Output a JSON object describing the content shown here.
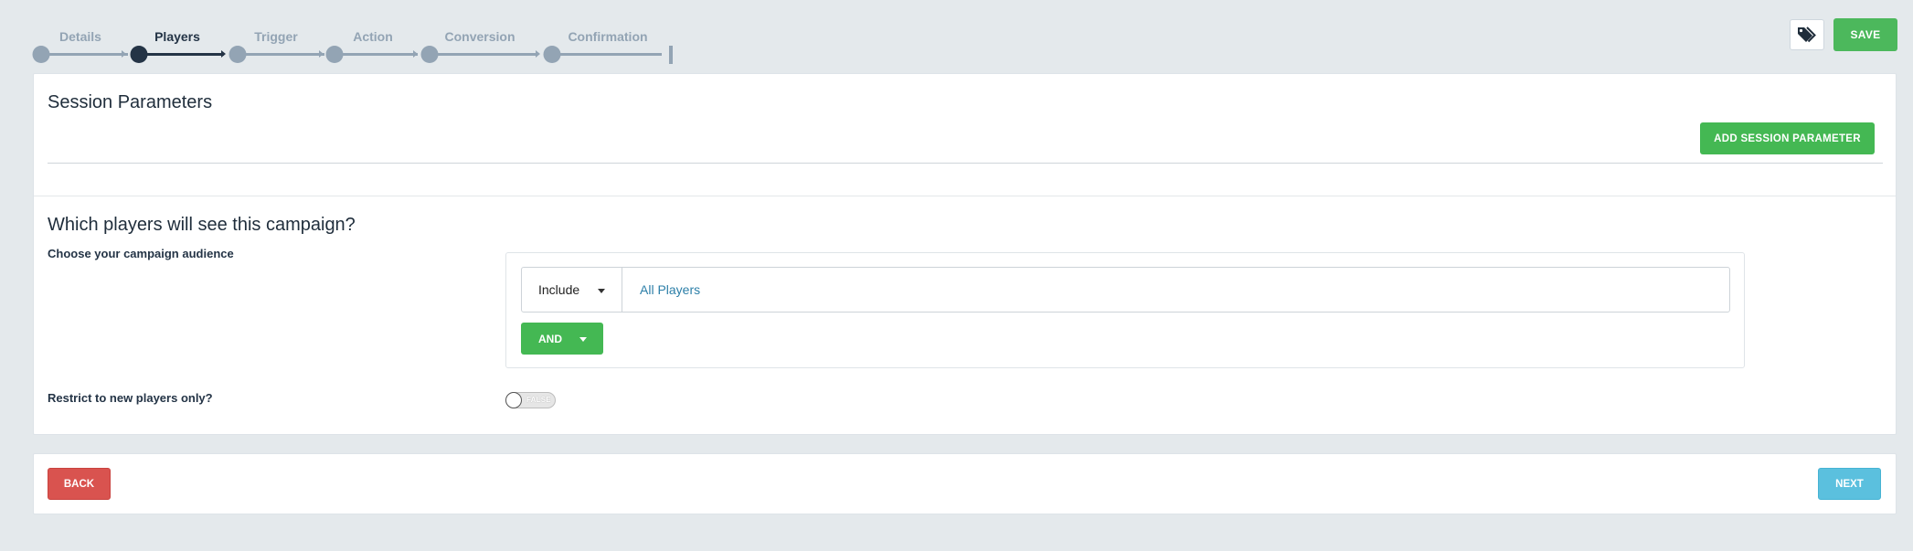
{
  "wizard": {
    "steps": [
      {
        "label": "Details",
        "active": false
      },
      {
        "label": "Players",
        "active": true
      },
      {
        "label": "Trigger",
        "active": false
      },
      {
        "label": "Action",
        "active": false
      },
      {
        "label": "Conversion",
        "active": false
      },
      {
        "label": "Confirmation",
        "active": false
      }
    ],
    "current_step": 2
  },
  "toolbar": {
    "tag_icon": "tags-icon",
    "save_label": "SAVE"
  },
  "session_parameters": {
    "title": "Session Parameters",
    "add_label": "ADD SESSION PARAMETER"
  },
  "audience": {
    "title": "Which players will see this campaign?",
    "choose_label": "Choose your campaign audience",
    "include_select": "Include",
    "segment": "All Players",
    "and_label": "AND"
  },
  "restrict": {
    "label": "Restrict to new players only?",
    "toggle_text": "FALSE"
  },
  "footer": {
    "back_label": "BACK",
    "next_label": "NEXT"
  },
  "colors": {
    "background": "#e4e9ec",
    "accent_green": "#4cb85c",
    "danger_red": "#d9534f",
    "info_blue": "#5bc0de",
    "step_active": "#243446",
    "step_inactive": "#93a4b4"
  }
}
